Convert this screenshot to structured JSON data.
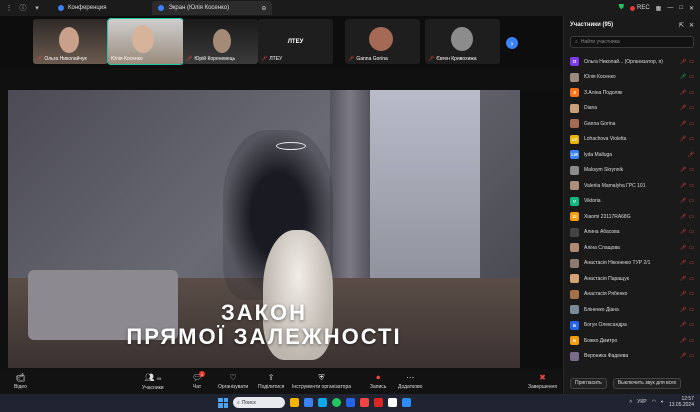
{
  "window": {
    "tabs": [
      {
        "label": "Конференция"
      },
      {
        "label": "Экран (Юлія Косенко)"
      }
    ],
    "rec_label": "REC"
  },
  "thumbnails": [
    {
      "name": "Ольга Николайчук",
      "color": "#6b5a4e"
    },
    {
      "name": "Юлія Косенко",
      "color": "#9a8b7c"
    },
    {
      "name": "Юрій Кореневець",
      "color": "#3a3a3a"
    },
    {
      "name": "ЛТЕУ",
      "color": "#1e1e1e"
    },
    {
      "name": "Ganna Gorina",
      "color": "#a56a55"
    },
    {
      "name": "Євген Кривохижа",
      "color": "#8d8c8c"
    }
  ],
  "slide": {
    "line1": "ЗАКОН",
    "line2": "ПРЯМОЇ ЗАЛЕЖНОСТІ"
  },
  "toolbar": {
    "video": "Відео",
    "participants": "Учасники",
    "participants_count": "95",
    "chat": "Чат",
    "chat_badge": "1",
    "organize": "Організувати",
    "share": "Поділитися",
    "host_tools": "Інструменти організатора",
    "record": "Запись",
    "more": "Додатково",
    "end": "Завершення"
  },
  "panel": {
    "title": "Участники (95)",
    "search_placeholder": "Найти участника",
    "invite": "Пригласить",
    "mute_all": "Выключить звук для всех",
    "participants": [
      {
        "initial": "О",
        "name": "Ольга Николай... (Организатор, я)",
        "color": "#7c3aed",
        "mic": "off",
        "cam": "off"
      },
      {
        "initial": "",
        "name": "Юлія Косенко",
        "color": "#9a8b7c",
        "mic": "on",
        "cam": "off"
      },
      {
        "initial": "З",
        "name": "З.Аліна Подоляк",
        "color": "#f97316",
        "mic": "off",
        "cam": "off"
      },
      {
        "initial": "",
        "name": "Diana",
        "color": "#c8a07a",
        "mic": "off",
        "cam": "off"
      },
      {
        "initial": "",
        "name": "Ganna Gorina",
        "color": "#a56a55",
        "mic": "off",
        "cam": "off"
      },
      {
        "initial": "LV",
        "name": "Lohachova Violetta",
        "color": "#eab308",
        "mic": "off",
        "cam": "off"
      },
      {
        "initial": "LM",
        "name": "lyda Malluga",
        "color": "#3b82f6",
        "mic": "off",
        "cam": ""
      },
      {
        "initial": "",
        "name": "Maksym Skrynnik",
        "color": "#8b8b8b",
        "mic": "off",
        "cam": "off"
      },
      {
        "initial": "",
        "name": "Valeriia Mamalyha ГРС 101",
        "color": "#b08f7a",
        "mic": "off",
        "cam": "off"
      },
      {
        "initial": "V",
        "name": "Viktoria",
        "color": "#10b981",
        "mic": "off",
        "cam": "off"
      },
      {
        "initial": "Xi",
        "name": "Xiaomi 23117RA68G",
        "color": "#f59e0b",
        "mic": "off",
        "cam": "off"
      },
      {
        "initial": "",
        "name": "Алина Абасова",
        "color": "#444444",
        "mic": "off",
        "cam": "off"
      },
      {
        "initial": "",
        "name": "Аліна Слащова",
        "color": "#b28a74",
        "mic": "off",
        "cam": "off"
      },
      {
        "initial": "",
        "name": "Анастасія Ніконенко ТУР 2/1",
        "color": "#8c7b6e",
        "mic": "off",
        "cam": "off"
      },
      {
        "initial": "",
        "name": "Анастасія Паращук",
        "color": "#d4a373",
        "mic": "off",
        "cam": "off"
      },
      {
        "initial": "",
        "name": "Анастасія Рябенко",
        "color": "#a47148",
        "mic": "off",
        "cam": "off"
      },
      {
        "initial": "",
        "name": "Бліненко Діана",
        "color": "#7a8a99",
        "mic": "off",
        "cam": "off"
      },
      {
        "initial": "Б",
        "name": "Богун Олександра",
        "color": "#2563eb",
        "mic": "off",
        "cam": "off"
      },
      {
        "initial": "Б",
        "name": "Божко Дмитро",
        "color": "#f59e0b",
        "mic": "off",
        "cam": "off"
      },
      {
        "initial": "",
        "name": "Вероника Фадеева",
        "color": "#7c6a8a",
        "mic": "off",
        "cam": "off"
      }
    ]
  },
  "taskbar": {
    "search": "Поиск",
    "lang": "УКР",
    "time": "12:57",
    "date": "13.05.2024"
  }
}
